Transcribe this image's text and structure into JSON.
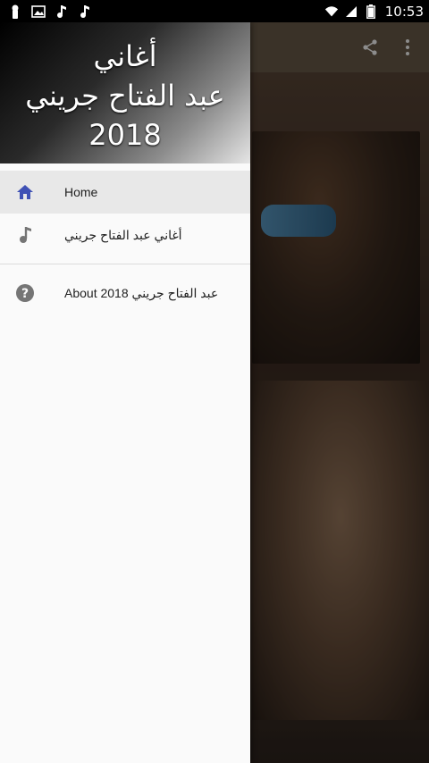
{
  "status_bar": {
    "time": "10:53",
    "icons": [
      "keyhole-icon",
      "image-icon",
      "music-note-icon",
      "music-note-icon",
      "wifi-icon",
      "signal-icon",
      "battery-icon"
    ]
  },
  "app_bar": {
    "actions": [
      "share-icon",
      "overflow-menu-icon"
    ]
  },
  "drawer": {
    "header": {
      "line1": "أغاني",
      "line2": "عبد الفتاح جريني",
      "line3": "2018"
    },
    "items": [
      {
        "label": "Home",
        "icon": "home-icon",
        "active": true
      },
      {
        "label": "أغاني عبد الفتاح جريني",
        "icon": "music-note-icon",
        "active": false
      },
      {
        "label": "About عبد الفتاح جريني 2018",
        "icon": "help-icon",
        "active": false
      }
    ]
  },
  "colors": {
    "accent": "#3f51b5",
    "drawer_bg": "#fafafa",
    "active_item_bg": "#e8e8e8",
    "icon_gray": "#757575"
  }
}
